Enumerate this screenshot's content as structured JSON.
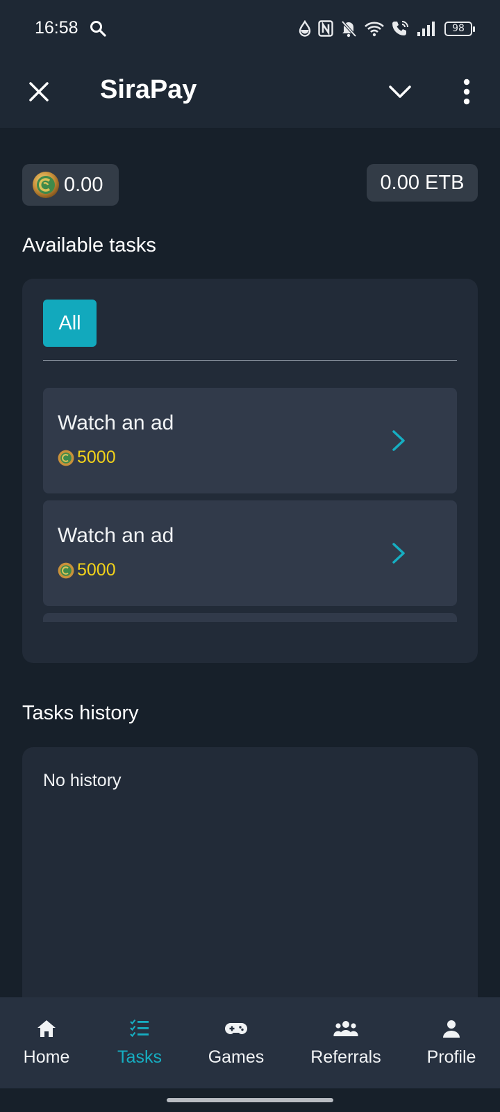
{
  "status_bar": {
    "time": "16:58",
    "battery": "98",
    "icons": [
      "search-icon",
      "water-drop-icon",
      "nfc-icon",
      "bell-off-icon",
      "wifi-icon",
      "wifi-calling-icon",
      "signal-icon",
      "battery-icon"
    ]
  },
  "app_bar": {
    "title": "SiraPay",
    "icons": [
      "close-icon",
      "chevron-down-icon",
      "more-vert-icon"
    ]
  },
  "balance": {
    "coins": "0.00",
    "etb": "0.00 ETB"
  },
  "available_tasks": {
    "heading": "Available tasks",
    "filter_label": "All",
    "items": [
      {
        "title": "Watch an ad",
        "reward": "5000"
      },
      {
        "title": "Watch an ad",
        "reward": "5000"
      }
    ]
  },
  "tasks_history": {
    "heading": "Tasks history",
    "empty_text": "No history"
  },
  "bottom_nav": {
    "active": "Tasks",
    "items": [
      {
        "label": "Home",
        "icon": "home-icon"
      },
      {
        "label": "Tasks",
        "icon": "tasks-icon"
      },
      {
        "label": "Games",
        "icon": "gamepad-icon"
      },
      {
        "label": "Referrals",
        "icon": "group-icon"
      },
      {
        "label": "Profile",
        "icon": "person-icon"
      }
    ]
  },
  "colors": {
    "background": "#17202a",
    "card": "#222b38",
    "accent": "#12a9bd",
    "reward": "#f2d21a"
  }
}
